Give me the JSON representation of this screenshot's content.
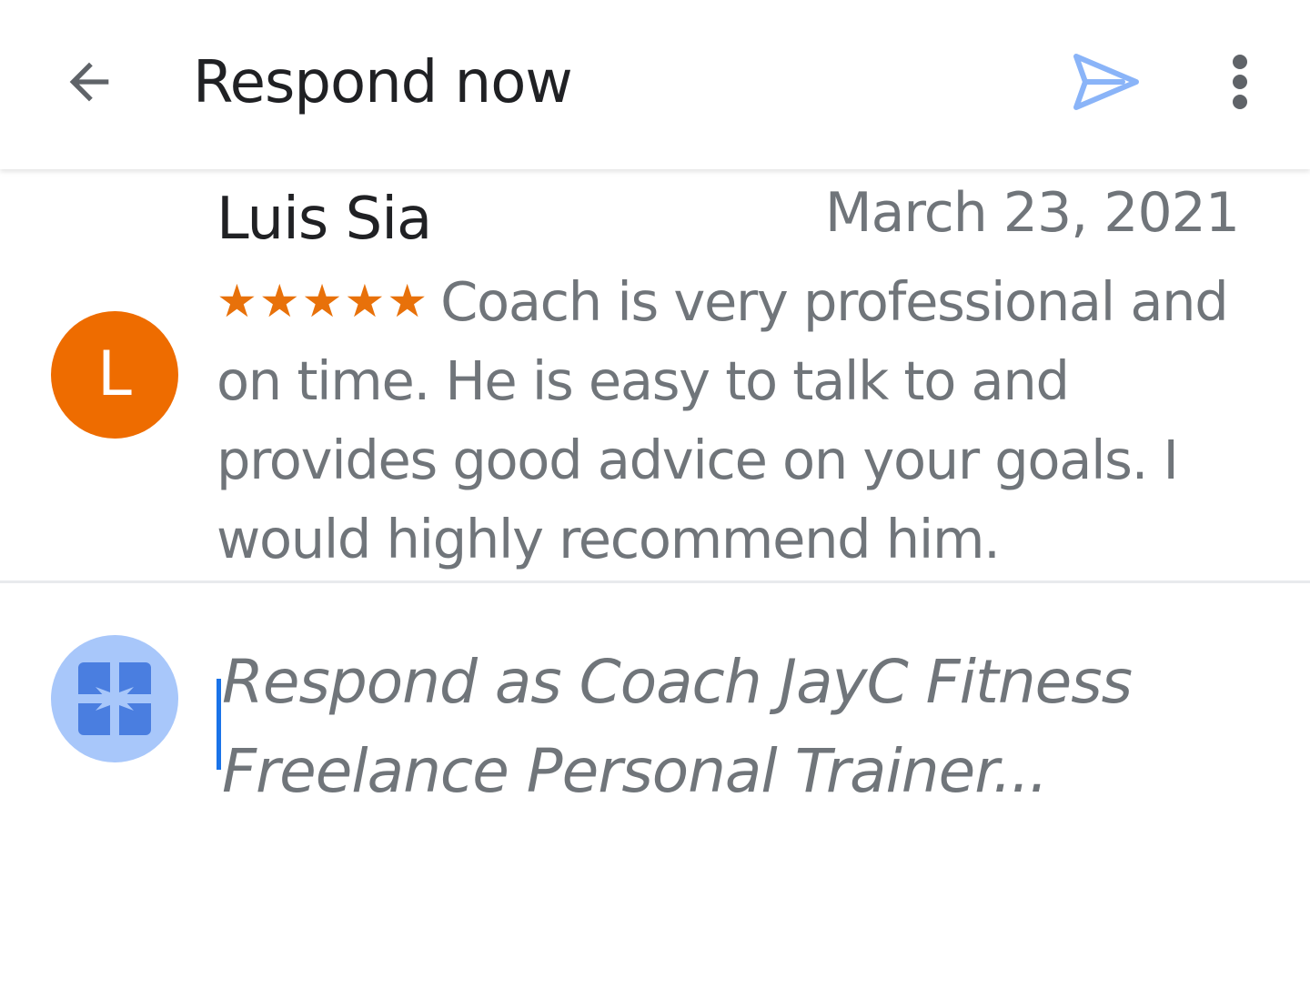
{
  "app_bar": {
    "title": "Respond now",
    "back_icon": "arrow-back-icon",
    "send_icon": "send-icon",
    "more_icon": "more-vert-icon"
  },
  "review": {
    "avatar_letter": "L",
    "reviewer_name": "Luis Sia",
    "date": "March 23, 2021",
    "rating": 5,
    "stars": "★★★★★",
    "text": "Coach is very professional and on time. He is easy to talk to and provides good advice on your goals. I would highly recommend him."
  },
  "reply": {
    "avatar_icon": "business-profile-icon",
    "placeholder": "Respond as Coach JayC Fitness Freelance Personal Trainer...",
    "value": ""
  },
  "colors": {
    "avatar_orange": "#ee6c00",
    "star_orange": "#e8710a",
    "send_blue": "#8ab4f8",
    "business_avatar_bg": "#a8c7fa",
    "business_icon_blue": "#4a7ee0",
    "caret_blue": "#1a73e8",
    "secondary_text": "#70757a",
    "primary_text": "#202124"
  }
}
